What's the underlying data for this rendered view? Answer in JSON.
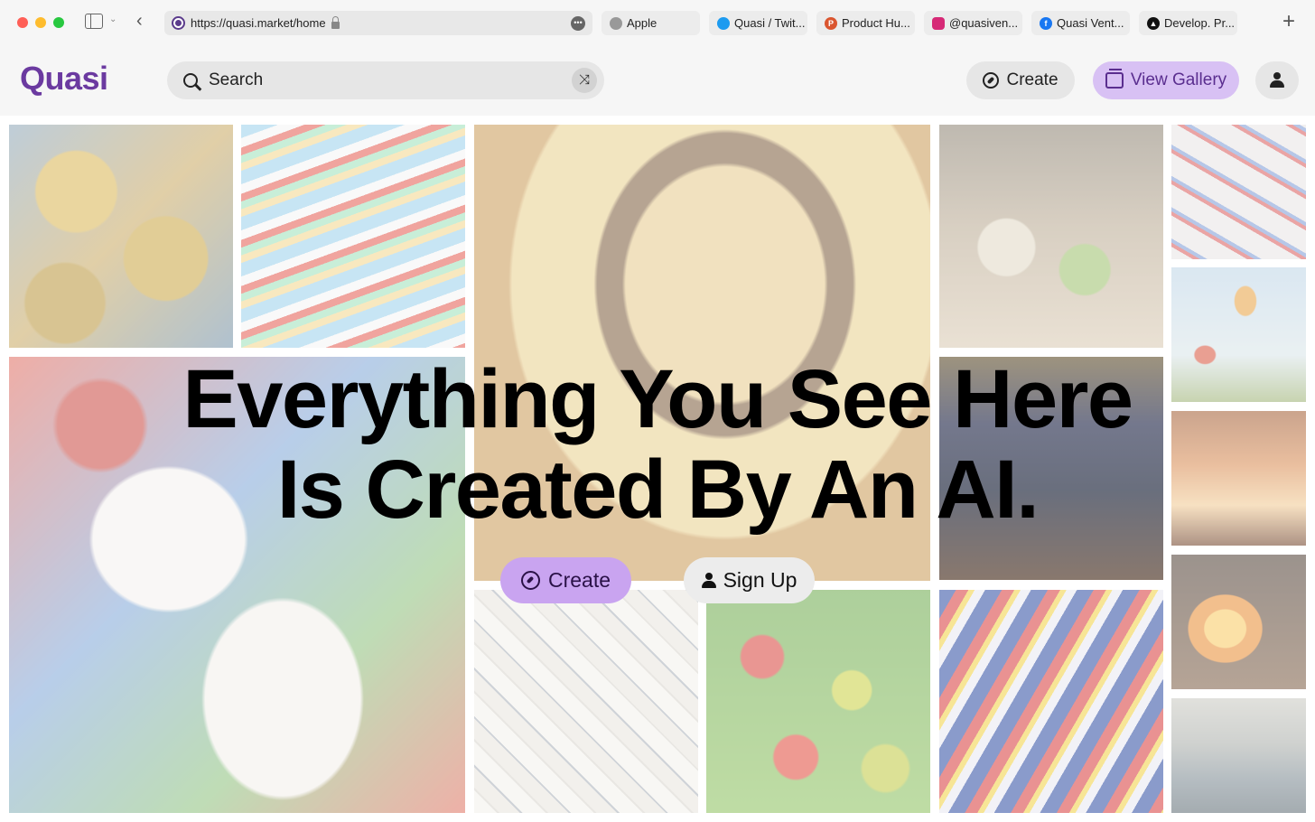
{
  "browser": {
    "url": "https://quasi.market/home",
    "tabs": [
      {
        "label": "Apple",
        "icon": "apple-icon"
      },
      {
        "label": "Quasi / Twit...",
        "icon": "twitter-icon"
      },
      {
        "label": "Product Hu...",
        "icon": "product-hunt-icon"
      },
      {
        "label": "@quasiven...",
        "icon": "instagram-icon"
      },
      {
        "label": "Quasi Vent...",
        "icon": "facebook-icon"
      },
      {
        "label": "Develop. Pr...",
        "icon": "develop-icon"
      }
    ]
  },
  "header": {
    "logo": "Quasi",
    "search_placeholder": "Search",
    "create_label": "Create",
    "gallery_label": "View Gallery"
  },
  "hero": {
    "line1": "Everything You See Here",
    "line2": "Is Created By An AI.",
    "create_label": "Create",
    "signup_label": "Sign Up"
  },
  "gallery": [
    {
      "name": "gallery-image-coins",
      "subject": "gold coins painting"
    },
    {
      "name": "gallery-image-race-cars",
      "subject": "red race cars painting"
    },
    {
      "name": "gallery-image-coffee-cup",
      "subject": "coffee cup painting"
    },
    {
      "name": "gallery-image-dinner-table",
      "subject": "dinner table painting"
    },
    {
      "name": "gallery-image-paint-tubes",
      "subject": "paint tubes painting"
    },
    {
      "name": "gallery-image-baseball",
      "subject": "baseball players painting"
    },
    {
      "name": "gallery-image-city-night",
      "subject": "city at night painting"
    },
    {
      "name": "gallery-image-balloons",
      "subject": "hot air balloons painting"
    },
    {
      "name": "gallery-image-interior",
      "subject": "sunlit interior painting"
    },
    {
      "name": "gallery-image-sketches",
      "subject": "sketches collage"
    },
    {
      "name": "gallery-image-apples",
      "subject": "apples painting"
    },
    {
      "name": "gallery-image-abstract",
      "subject": "red and blue abstract painting"
    },
    {
      "name": "gallery-image-fire",
      "subject": "fire painting"
    },
    {
      "name": "gallery-image-ship",
      "subject": "ship at sea painting"
    }
  ],
  "colors": {
    "brand": "#6b3aa0",
    "accent_button": "#c9a4f0",
    "gallery_button": "#d8c1f4"
  }
}
